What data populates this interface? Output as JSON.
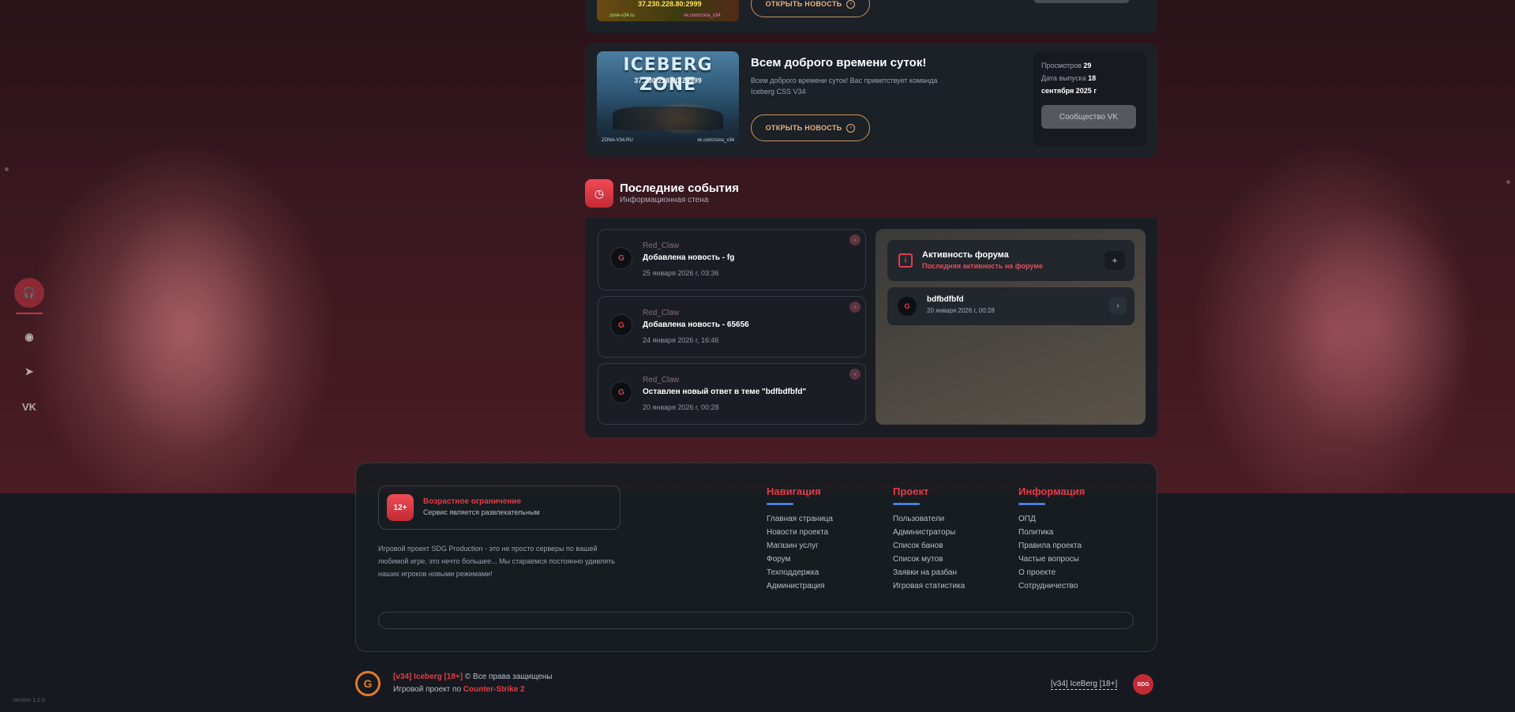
{
  "news_top": {
    "thumb_ip": "37.230.228.80:2999",
    "thumb_left": "zone-v34.ru",
    "thumb_right": "vk.com/zona_v34",
    "open_label": "ОТКРЫТЬ НОВОСТЬ"
  },
  "news": {
    "thumb_logo": "ICEBERG ZONE",
    "thumb_ip": "37.230.228.80:29999",
    "thumb_foot_left": "ZONA-V34.RU",
    "thumb_foot_right": "vk.com/zona_v34",
    "title": "Всем доброго времени суток!",
    "description": "Всем доброго времени суток! Вас приветствует команда Iceberg CSS V34",
    "open_label": "ОТКРЫТЬ НОВОСТЬ",
    "views_label": "Просмотров",
    "views_value": "29",
    "release_label": "Дата выпуска",
    "release_value_1": "18",
    "release_value_2": "сентября 2025 г",
    "community_button": "Сообщество VK"
  },
  "events": {
    "title": "Последние события",
    "subtitle": "Информационная стена",
    "items": [
      {
        "user": "Red_Claw",
        "text": "Добавлена новость - fg",
        "date": "25 января 2026 г, 03:36"
      },
      {
        "user": "Red_Claw",
        "text": "Добавлена новость - 65656",
        "date": "24 января 2026 г, 16:46"
      },
      {
        "user": "Red_Claw",
        "text": "Оставлен новый ответ в теме \"bdfbdfbfd\"",
        "date": "20 января 2026 г, 00:28"
      }
    ]
  },
  "forum": {
    "title": "Активность форума",
    "subtitle": "Последняя активность на форуме",
    "item_name": "bdfbdfbfd",
    "item_date": "20 января 2026 г, 00:28"
  },
  "rail": {
    "support": "🎧",
    "discord": "◉",
    "telegram": "➤",
    "vk": "VK"
  },
  "footer": {
    "age_badge": "12+",
    "age_title": "Возрастное ограничение",
    "age_sub": "Сервис является развлекательным",
    "about": "Игровой проект SDG Production - это не просто серверы по вашей любимой игре, это нечто большее... Мы стараемся постоянно удивлять наших игроков новыми режимами!",
    "nav": {
      "head": "Навигация",
      "links": [
        "Главная страница",
        "Новости проекта",
        "Магазин услуг",
        "Форум",
        "Техподдержка",
        "Администрация"
      ]
    },
    "project": {
      "head": "Проект",
      "links": [
        "Пользователи",
        "Администраторы",
        "Список банов",
        "Список мутов",
        "Заявки на разбан",
        "Игровая статистика"
      ]
    },
    "info": {
      "head": "Информация",
      "links": [
        "ОПД",
        "Политика",
        "Правила проекта",
        "Частые вопросы",
        "О проекте",
        "Сотрудничество"
      ]
    }
  },
  "bottom": {
    "logo": "G",
    "server_name": "[v34] Iceberg [18+]",
    "rights": "© Все права защищены",
    "project_prefix": "Игровой проект по",
    "game": "Counter-Strike 2",
    "right_link": "[v34] IceBerg [18+]",
    "sdg": "SDG",
    "version": "Version 1.2.5"
  },
  "colors": {
    "accent": "#e23c47",
    "gold": "#c9975c",
    "link_underline": "#4b7fd6"
  }
}
